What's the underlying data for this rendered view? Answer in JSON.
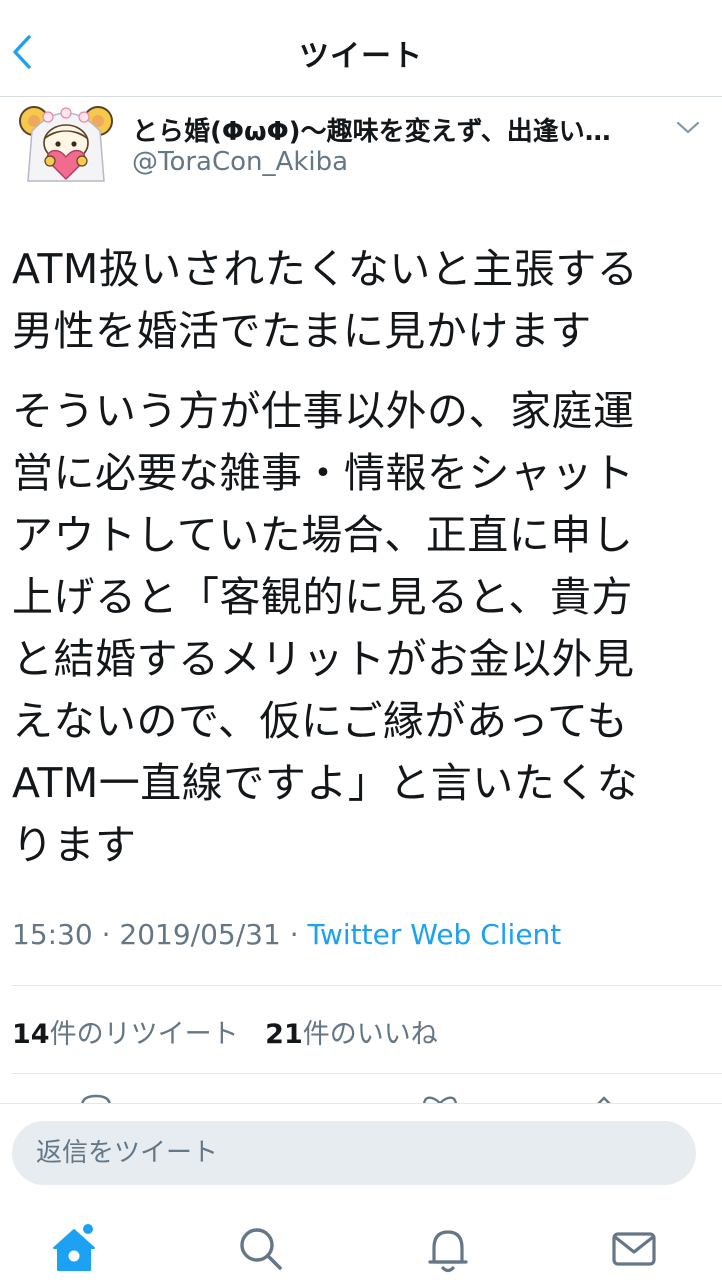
{
  "header": {
    "title": "ツイート",
    "back_icon": "chevron-left-icon"
  },
  "author": {
    "display_name": "とら婚(ΦωΦ)〜趣味を変えず、出逢い…",
    "handle": "@ToraCon_Akiba",
    "more_icon": "chevron-down-icon"
  },
  "tweet": {
    "paragraph1_line1": "ATM扱いされたくないと主張する",
    "paragraph1_line2": "男性を婚活でたまに見かけます",
    "paragraph2_lines": [
      "そういう方が仕事以外の、家庭運",
      "営に必要な雑事・情報をシャット",
      "アウトしていた場合、正直に申し",
      "上げると「客観的に見ると、貴方",
      "と結婚するメリットがお金以外見",
      "えないので、仮にご縁があっても",
      "ATM一直線ですよ」と言いたくな",
      "ります"
    ]
  },
  "meta": {
    "time": "15:30",
    "date": "2019/05/31",
    "separator": "·",
    "client": "Twitter Web Client"
  },
  "stats": {
    "retweet_count": "14",
    "retweet_label": "件のリツイート",
    "like_count": "21",
    "like_label": "件のいいね"
  },
  "reply": {
    "placeholder": "返信をツイート"
  },
  "tabs": [
    {
      "icon": "home-icon",
      "active": true
    },
    {
      "icon": "search-icon",
      "active": false
    },
    {
      "icon": "bell-icon",
      "active": false
    },
    {
      "icon": "mail-icon",
      "active": false
    }
  ],
  "colors": {
    "accent": "#1da1f2",
    "text": "#14171a",
    "secondary": "#657786",
    "divider": "#e1e8ed"
  }
}
